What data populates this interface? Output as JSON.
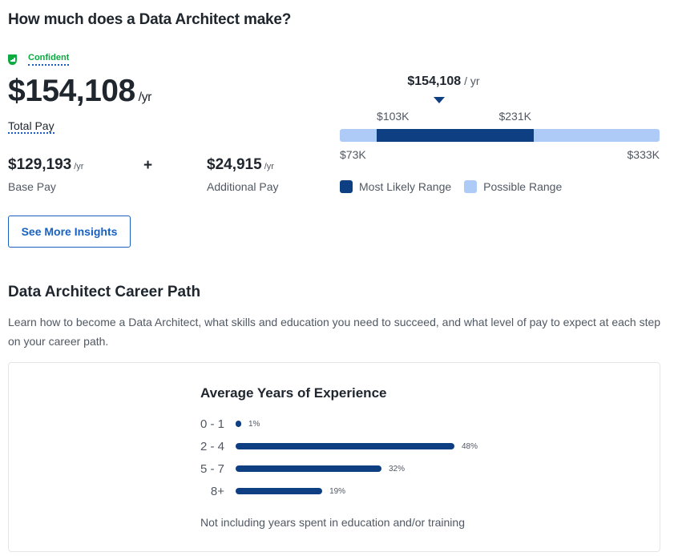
{
  "salary": {
    "title": "How much does a Data Architect make?",
    "confidence": {
      "icon": "shield-bar-chart-icon",
      "label": "Confident",
      "color": "#0caa41"
    },
    "total": {
      "amount": "$154,108",
      "unit": "/yr",
      "label": "Total Pay"
    },
    "base": {
      "amount": "$129,193",
      "unit": "/yr",
      "label": "Base Pay"
    },
    "plus_sign": "+",
    "additional": {
      "amount": "$24,915",
      "unit": "/yr",
      "label": "Additional Pay"
    },
    "insights_button": "See More Insights"
  },
  "range_chart": {
    "median": {
      "value": 154108,
      "label": "$154,108",
      "unit": "/ yr"
    },
    "possible_range": {
      "min": 73000,
      "max": 333000,
      "min_label": "$73K",
      "max_label": "$333K"
    },
    "likely_range": {
      "min": 103000,
      "max": 231000,
      "min_label": "$103K",
      "max_label": "$231K"
    },
    "legend": [
      {
        "label": "Most Likely Range",
        "color": "#0d3f82"
      },
      {
        "label": "Possible Range",
        "color": "#aecbf7"
      }
    ]
  },
  "career": {
    "title": "Data Architect Career Path",
    "description": "Learn how to become a Data Architect, what skills and education you need to succeed, and what level of pay to expect at each step on your career path."
  },
  "chart_data": {
    "type": "bar",
    "orientation": "horizontal",
    "title": "Average Years of Experience",
    "categories": [
      "0 - 1",
      "2 - 4",
      "5 - 7",
      "8+"
    ],
    "values": [
      1,
      48,
      32,
      19
    ],
    "value_labels": [
      "1%",
      "48%",
      "32%",
      "19%"
    ],
    "unit": "%",
    "xlabel": "",
    "ylabel": "",
    "grid": false,
    "bar_color": "#0d3f82",
    "note": "Not including years spent in education and/or training"
  }
}
